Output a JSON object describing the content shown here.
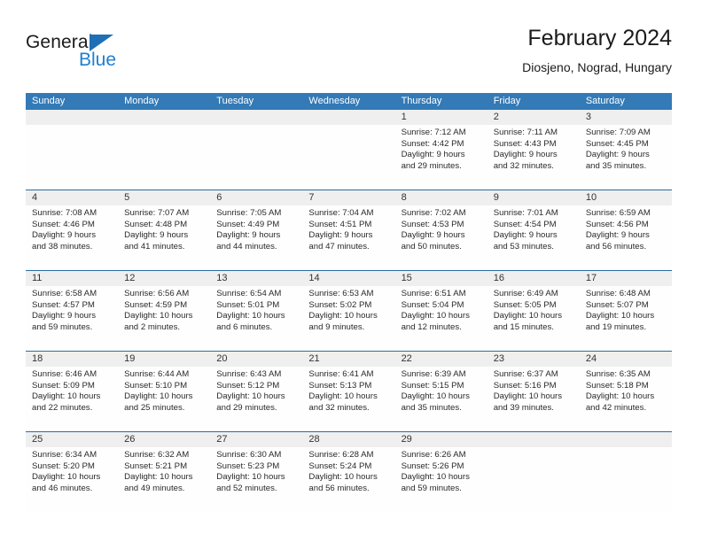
{
  "brand": {
    "name_top": "General",
    "name_bottom": "Blue",
    "accent_color": "#1f7fd0",
    "triangle_color": "#1f6fb6"
  },
  "header": {
    "title": "February 2024",
    "subtitle": "Diosjeno, Nograd, Hungary"
  },
  "theme": {
    "header_blue": "#337ab7",
    "row_rule_blue": "#2b6ca3",
    "day_band_gray": "#efefef"
  },
  "weekdays": [
    "Sunday",
    "Monday",
    "Tuesday",
    "Wednesday",
    "Thursday",
    "Friday",
    "Saturday"
  ],
  "weeks": [
    [
      {
        "day": "",
        "lines": []
      },
      {
        "day": "",
        "lines": []
      },
      {
        "day": "",
        "lines": []
      },
      {
        "day": "",
        "lines": []
      },
      {
        "day": "1",
        "lines": [
          "Sunrise: 7:12 AM",
          "Sunset: 4:42 PM",
          "Daylight: 9 hours",
          "and 29 minutes."
        ]
      },
      {
        "day": "2",
        "lines": [
          "Sunrise: 7:11 AM",
          "Sunset: 4:43 PM",
          "Daylight: 9 hours",
          "and 32 minutes."
        ]
      },
      {
        "day": "3",
        "lines": [
          "Sunrise: 7:09 AM",
          "Sunset: 4:45 PM",
          "Daylight: 9 hours",
          "and 35 minutes."
        ]
      }
    ],
    [
      {
        "day": "4",
        "lines": [
          "Sunrise: 7:08 AM",
          "Sunset: 4:46 PM",
          "Daylight: 9 hours",
          "and 38 minutes."
        ]
      },
      {
        "day": "5",
        "lines": [
          "Sunrise: 7:07 AM",
          "Sunset: 4:48 PM",
          "Daylight: 9 hours",
          "and 41 minutes."
        ]
      },
      {
        "day": "6",
        "lines": [
          "Sunrise: 7:05 AM",
          "Sunset: 4:49 PM",
          "Daylight: 9 hours",
          "and 44 minutes."
        ]
      },
      {
        "day": "7",
        "lines": [
          "Sunrise: 7:04 AM",
          "Sunset: 4:51 PM",
          "Daylight: 9 hours",
          "and 47 minutes."
        ]
      },
      {
        "day": "8",
        "lines": [
          "Sunrise: 7:02 AM",
          "Sunset: 4:53 PM",
          "Daylight: 9 hours",
          "and 50 minutes."
        ]
      },
      {
        "day": "9",
        "lines": [
          "Sunrise: 7:01 AM",
          "Sunset: 4:54 PM",
          "Daylight: 9 hours",
          "and 53 minutes."
        ]
      },
      {
        "day": "10",
        "lines": [
          "Sunrise: 6:59 AM",
          "Sunset: 4:56 PM",
          "Daylight: 9 hours",
          "and 56 minutes."
        ]
      }
    ],
    [
      {
        "day": "11",
        "lines": [
          "Sunrise: 6:58 AM",
          "Sunset: 4:57 PM",
          "Daylight: 9 hours",
          "and 59 minutes."
        ]
      },
      {
        "day": "12",
        "lines": [
          "Sunrise: 6:56 AM",
          "Sunset: 4:59 PM",
          "Daylight: 10 hours",
          "and 2 minutes."
        ]
      },
      {
        "day": "13",
        "lines": [
          "Sunrise: 6:54 AM",
          "Sunset: 5:01 PM",
          "Daylight: 10 hours",
          "and 6 minutes."
        ]
      },
      {
        "day": "14",
        "lines": [
          "Sunrise: 6:53 AM",
          "Sunset: 5:02 PM",
          "Daylight: 10 hours",
          "and 9 minutes."
        ]
      },
      {
        "day": "15",
        "lines": [
          "Sunrise: 6:51 AM",
          "Sunset: 5:04 PM",
          "Daylight: 10 hours",
          "and 12 minutes."
        ]
      },
      {
        "day": "16",
        "lines": [
          "Sunrise: 6:49 AM",
          "Sunset: 5:05 PM",
          "Daylight: 10 hours",
          "and 15 minutes."
        ]
      },
      {
        "day": "17",
        "lines": [
          "Sunrise: 6:48 AM",
          "Sunset: 5:07 PM",
          "Daylight: 10 hours",
          "and 19 minutes."
        ]
      }
    ],
    [
      {
        "day": "18",
        "lines": [
          "Sunrise: 6:46 AM",
          "Sunset: 5:09 PM",
          "Daylight: 10 hours",
          "and 22 minutes."
        ]
      },
      {
        "day": "19",
        "lines": [
          "Sunrise: 6:44 AM",
          "Sunset: 5:10 PM",
          "Daylight: 10 hours",
          "and 25 minutes."
        ]
      },
      {
        "day": "20",
        "lines": [
          "Sunrise: 6:43 AM",
          "Sunset: 5:12 PM",
          "Daylight: 10 hours",
          "and 29 minutes."
        ]
      },
      {
        "day": "21",
        "lines": [
          "Sunrise: 6:41 AM",
          "Sunset: 5:13 PM",
          "Daylight: 10 hours",
          "and 32 minutes."
        ]
      },
      {
        "day": "22",
        "lines": [
          "Sunrise: 6:39 AM",
          "Sunset: 5:15 PM",
          "Daylight: 10 hours",
          "and 35 minutes."
        ]
      },
      {
        "day": "23",
        "lines": [
          "Sunrise: 6:37 AM",
          "Sunset: 5:16 PM",
          "Daylight: 10 hours",
          "and 39 minutes."
        ]
      },
      {
        "day": "24",
        "lines": [
          "Sunrise: 6:35 AM",
          "Sunset: 5:18 PM",
          "Daylight: 10 hours",
          "and 42 minutes."
        ]
      }
    ],
    [
      {
        "day": "25",
        "lines": [
          "Sunrise: 6:34 AM",
          "Sunset: 5:20 PM",
          "Daylight: 10 hours",
          "and 46 minutes."
        ]
      },
      {
        "day": "26",
        "lines": [
          "Sunrise: 6:32 AM",
          "Sunset: 5:21 PM",
          "Daylight: 10 hours",
          "and 49 minutes."
        ]
      },
      {
        "day": "27",
        "lines": [
          "Sunrise: 6:30 AM",
          "Sunset: 5:23 PM",
          "Daylight: 10 hours",
          "and 52 minutes."
        ]
      },
      {
        "day": "28",
        "lines": [
          "Sunrise: 6:28 AM",
          "Sunset: 5:24 PM",
          "Daylight: 10 hours",
          "and 56 minutes."
        ]
      },
      {
        "day": "29",
        "lines": [
          "Sunrise: 6:26 AM",
          "Sunset: 5:26 PM",
          "Daylight: 10 hours",
          "and 59 minutes."
        ]
      },
      {
        "day": "",
        "lines": []
      },
      {
        "day": "",
        "lines": []
      }
    ]
  ]
}
